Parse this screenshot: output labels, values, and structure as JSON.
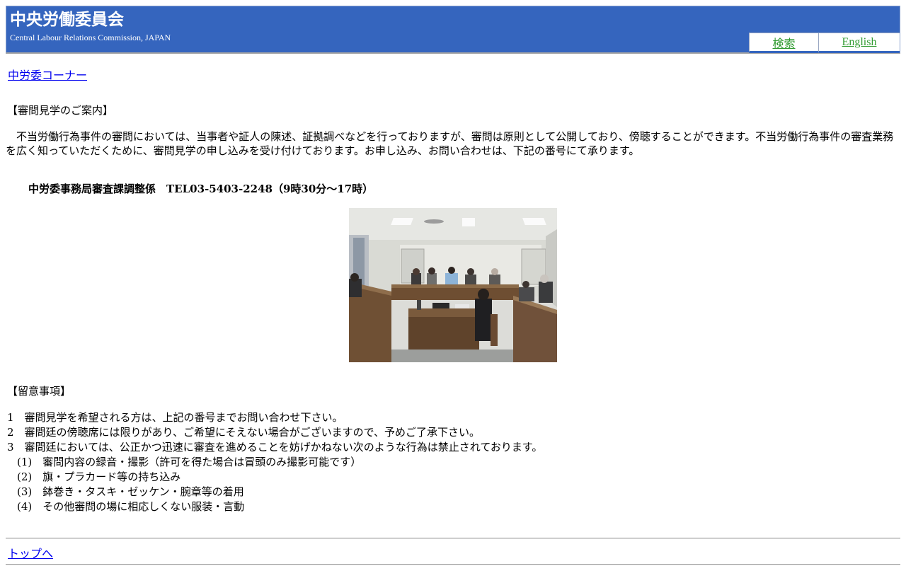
{
  "header": {
    "title": "中央労働委員会",
    "subtitle": "Central Labour Relations Commission, JAPAN",
    "nav": {
      "search_label": "検索",
      "english_label": "English"
    }
  },
  "breadcrumb": {
    "corner_link": "中労委コーナー"
  },
  "guide": {
    "heading": "【審問見学のご案内】",
    "intro": "不当労働行為事件の審問においては、当事者や証人の陳述、証拠調べなどを行っておりますが、審問は原則として公開しており、傍聴することができます。不当労働行為事件の審査業務を広く知っていただくために、審問見学の申し込みを受け付けております。お申し込み、お問い合わせは、下記の番号にて承ります。",
    "contact": "中労委事務局審査課調整係　TEL03-5403-2248（9時30分～17時）"
  },
  "notes": {
    "heading": "【留意事項】",
    "items": [
      "1　審問見学を希望される方は、上記の番号までお問い合わせ下さい。",
      "2　審問廷の傍聴席には限りがあり、ご希望にそえない場合がございますので、予めご了承下さい。",
      "3　審問廷においては、公正かつ迅速に審査を進めることを妨げかねない次のような行為は禁止されております。"
    ],
    "sub_items": [
      "(1)　審問内容の録音・撮影（許可を得た場合は冒頭のみ撮影可能です）",
      "(2)　旗・プラカード等の持ち込み",
      "(3)　鉢巻き・タスキ・ゼッケン・腕章等の着用",
      "(4)　その他審問の場に相応しくない服装・言動"
    ]
  },
  "footer": {
    "top_link": "トップへ"
  },
  "colors": {
    "header_bg": "#3565be",
    "nav_link": "#2f9a2f",
    "link": "#0000ee"
  }
}
